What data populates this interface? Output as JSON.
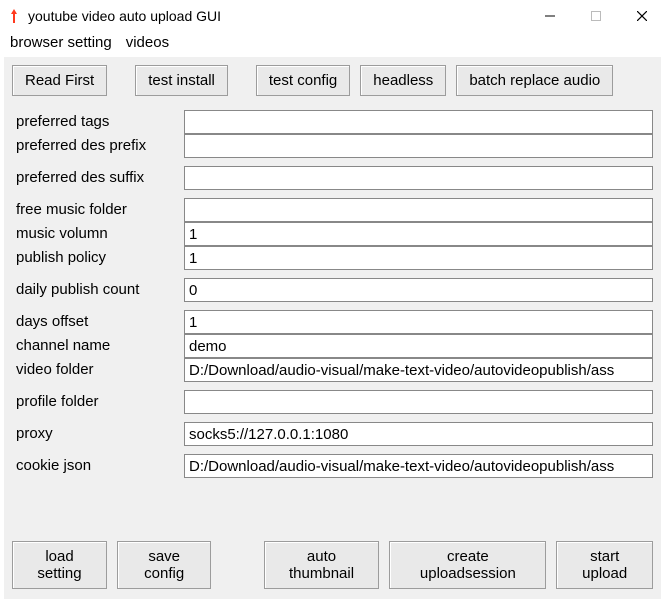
{
  "window": {
    "title": "youtube video auto upload GUI"
  },
  "menu": {
    "browser_setting": "browser setting",
    "videos": "videos"
  },
  "topButtons": {
    "read_first": "Read First",
    "test_install": "test install",
    "test_config": "test config",
    "headless": "headless",
    "batch_replace_audio": "batch replace audio"
  },
  "form": {
    "preferred_tags": {
      "label": "preferred tags",
      "value": ""
    },
    "preferred_des_prefix": {
      "label": "preferred des prefix",
      "value": ""
    },
    "preferred_des_suffix": {
      "label": "preferred des suffix",
      "value": ""
    },
    "free_music_folder": {
      "label": "free music folder",
      "value": ""
    },
    "music_volumn": {
      "label": "music volumn",
      "value": "1"
    },
    "publish_policy": {
      "label": "publish policy",
      "value": "1"
    },
    "daily_publish_count": {
      "label": "daily publish count",
      "value": "0"
    },
    "days_offset": {
      "label": "days offset",
      "value": "1"
    },
    "channel_name": {
      "label": "channel name",
      "value": "demo"
    },
    "video_folder": {
      "label": "video folder",
      "value": "D:/Download/audio-visual/make-text-video/autovideopublish/ass"
    },
    "profile_folder": {
      "label": "profile folder",
      "value": ""
    },
    "proxy": {
      "label": "proxy",
      "value": "socks5://127.0.0.1:1080"
    },
    "cookie_json": {
      "label": "cookie json",
      "value": "D:/Download/audio-visual/make-text-video/autovideopublish/ass"
    }
  },
  "bottomButtons": {
    "load_setting": "load setting",
    "save_config": "save config",
    "auto_thumbnail": "auto thumbnail",
    "create_uploadsession": "create uploadsession",
    "start_upload": "start upload"
  }
}
